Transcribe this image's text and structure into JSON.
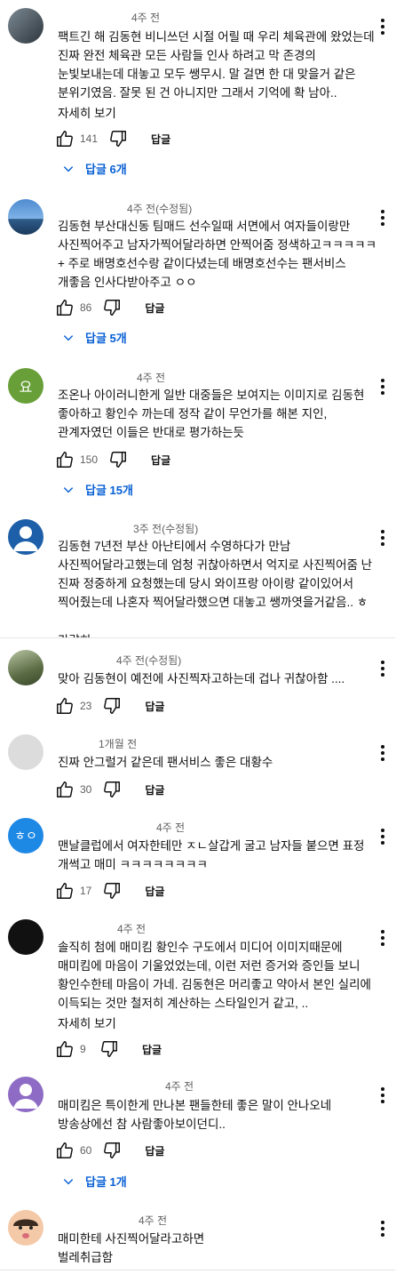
{
  "comments": [
    {
      "time": "4주 전",
      "text": "팩트긴 해 김동현 비니쓰던 시절 어릴 때 우리 체육관에 왔었는데 진짜 완전 체육관 모든 사람들 인사 하려고 막 존경의 눈빛보내는데 대놓고 모두 쌩무시. 말 걸면 한 대 맞을거 같은 분위기였음. 잘못 된 건 아니지만 그래서 기억에 확 남아..",
      "more": "자세히 보기",
      "likes": "141",
      "reply": "답글",
      "replies": "답글 6개",
      "avatar_color": "#4a5560"
    },
    {
      "time": "4주 전(수정됨)",
      "text": "김동현 부산대신동 팀매드 선수일때 서면에서 여자들이랑만 사진찍어주고 남자가찍어달라하면 안찍어줌 정색하고ㅋㅋㅋㅋㅋ + 주로 배명호선수랑 같이다녔는데 배명호선수는 팬서비스 개좋음 인사다받아주고 ㅇㅇ",
      "likes": "86",
      "reply": "답글",
      "replies": "답글 5개",
      "avatar_color": "#3a6fb0"
    },
    {
      "time": "4주 전",
      "text": "조온나 아이러니한게 일반 대중들은 보여지는 이미지로 김동현 좋아하고 황인수 까는데 정작 같이 무언가를 해본 지인, 관계자였던 이들은 반대로 평가하는듯",
      "likes": "150",
      "reply": "답글",
      "replies": "답글 15개",
      "avatar_letter": "요",
      "avatar_color": "#689f38"
    },
    {
      "time": "3주 전(수정됨)",
      "text": "김동현  7년전 부산 아난티에서 수영하다가 만남  사진찍어달라고했는데  엄청 귀찮아하면서 억지로  사진찍어줌  난 진짜 정중하게 요청했는데   당시 와이프랑  아이랑 같이있어서 찍어줬는데 나혼자 찍어달라했으면  대놓고 쌩까엿을거같음.. ㅎ",
      "more": "간략히",
      "avatar_color": "#1d5fa8"
    },
    {
      "time": "4주 전(수정됨)",
      "text": "맞아 김동현이 예전에 사진찍자고하는데 겁나 귀찮아함 ....",
      "likes": "23",
      "reply": "답글",
      "avatar_color": "#6a7a55"
    },
    {
      "time": "1개월 전",
      "text": "진짜 안그럴거 같은데 팬서비스 좋은 대황수",
      "likes": "30",
      "reply": "답글",
      "avatar_color": "#dcdcdc"
    },
    {
      "time": "4주 전",
      "text": "맨날클럽에서 여자한테만 ㅈㄴ살갑게 굴고 남자들 붙으면 표정 개썩고 매미 ㅋㅋㅋㅋㅋㅋㅋㅋ",
      "likes": "17",
      "reply": "답글",
      "avatar_letter": "ㅎㅇ",
      "avatar_color": "#1e88e5"
    },
    {
      "time": "4주 전",
      "text": "솔직히 첨에 매미킴 황인수 구도에서 미디어 이미지때문에 매미킴에 마음이 기울었었는데, 이런 저런 증거와 증인들 보니 황인수한테 마음이 가네. 김동현은 머리좋고 약아서 본인 실리에 이득되는 것만 철저히 계산하는 스타일인거 같고, ..",
      "more": "자세히 보기",
      "likes": "9",
      "reply": "답글",
      "avatar_color": "#111111"
    },
    {
      "time": "4주 전",
      "text": "매미킴은 특이한게 만나본 팬들한테 좋은 말이 안나오네 방송상에선 참 사람좋아보이던디..",
      "likes": "60",
      "reply": "답글",
      "replies": "답글 1개",
      "avatar_color": "#8e6bc4"
    },
    {
      "time": "4주 전",
      "text": "매미한테 사진찍어달라고하면\n벌레취급함",
      "avatar_color": "#f4c9a8"
    }
  ],
  "icons": {
    "like": "thumbs-up-icon",
    "dislike": "thumbs-down-icon",
    "menu": "more-vert-icon",
    "expand": "chevron-down-icon"
  }
}
